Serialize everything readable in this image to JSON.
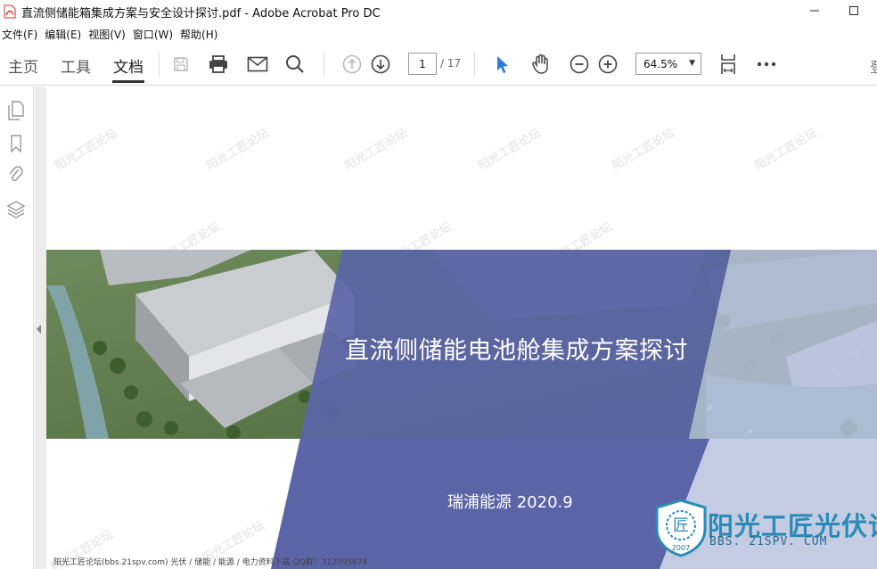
{
  "window": {
    "title": "直流侧储能箱集成方案与安全设计探讨.pdf - Adobe Acrobat Pro DC",
    "icon": "acrobat-pdf-icon"
  },
  "menubar": {
    "items": [
      {
        "label": "文件(F)"
      },
      {
        "label": "编辑(E)"
      },
      {
        "label": "视图(V)"
      },
      {
        "label": "窗口(W)"
      },
      {
        "label": "帮助(H)"
      }
    ]
  },
  "toolbar": {
    "tabs": [
      {
        "label": "主页"
      },
      {
        "label": "工具"
      },
      {
        "label": "文档",
        "active": true
      }
    ],
    "page_current": "1",
    "page_total": "/ 17",
    "zoom": "64.5%",
    "cut_label": "登"
  },
  "document": {
    "title": "直流侧储能电池舱集成方案探讨",
    "subtitle": "瑞浦能源 2020.9",
    "footer": "阳光工匠论坛(bbs.21spv.com)     光伏 / 储能 / 能源 / 电力资料下载     QQ群：312095674",
    "watermark_text": "阳光工匠论坛",
    "logo_text": "阳光工匠光伏论坛",
    "logo_url": "BBS. 21SPV. COM",
    "logo_year": "2007",
    "logo_glyph": "匠"
  },
  "colors": {
    "accent_blue": "#2b79d8",
    "banner_blue": "#5b64a6",
    "banner_light": "#b5bfdc"
  }
}
